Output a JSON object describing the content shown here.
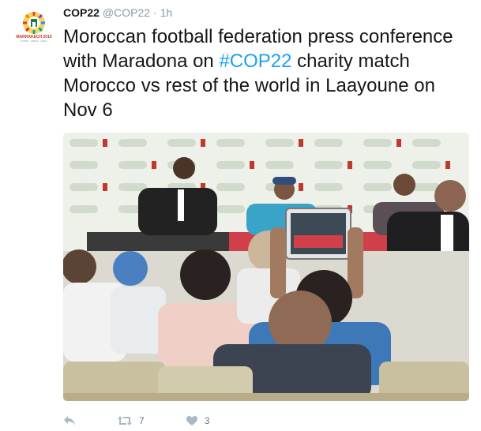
{
  "tweet": {
    "avatar_icon": "cop22-marrakech-logo",
    "logo_text": "MARRAKECH 2016",
    "logo_subtext": "COP22 · CMP12 · CMA1",
    "name": "COP22",
    "handle": "@COP22",
    "separator": "·",
    "time": "1h",
    "text_before": "Moroccan football federation press conference with Maradona on ",
    "hashtag": "#COP22",
    "text_after": " charity match Morocco vs rest of the world in Laayoune on Nov 6",
    "hashtag_color": "#1da1f2"
  },
  "photo": {
    "description_icon": "press-conference-photo"
  },
  "actions": {
    "reply_icon": "reply-icon",
    "retweet_icon": "retweet-icon",
    "retweet_count": "7",
    "like_icon": "heart-icon",
    "like_count": "3"
  }
}
